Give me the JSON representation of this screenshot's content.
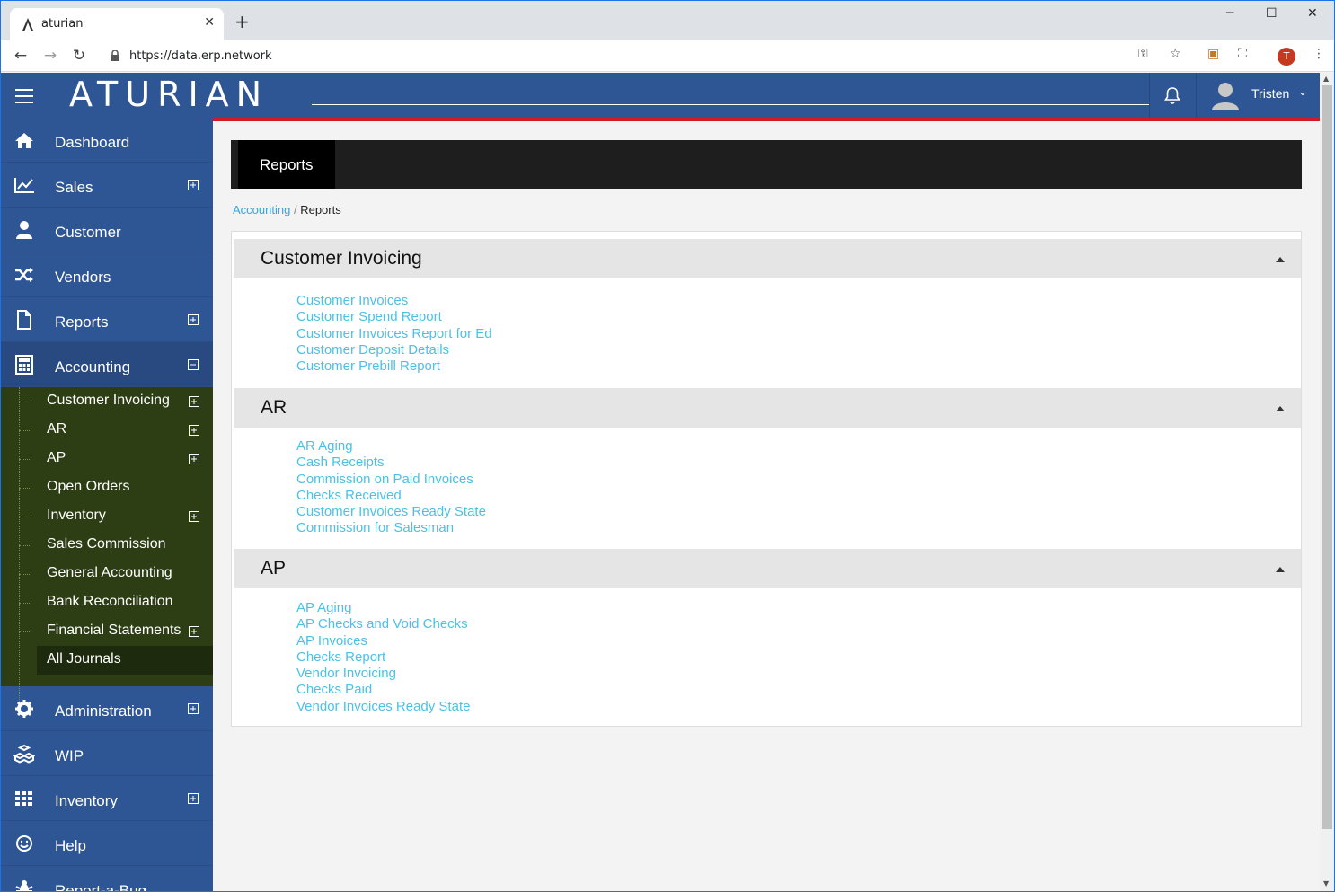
{
  "browser": {
    "tab_title": "aturian",
    "tab_close": "✕",
    "new_tab": "+",
    "url": "https://data.erp.network",
    "profile_initial": "T",
    "window_controls": [
      "─",
      "☐",
      "✕"
    ]
  },
  "header": {
    "logo": "ATURIAN",
    "user_name": "Tristen"
  },
  "sidebar": {
    "items": [
      {
        "label": "Dashboard",
        "icon": "home-icon",
        "expandable": false
      },
      {
        "label": "Sales",
        "icon": "chart-line-icon",
        "expandable": true
      },
      {
        "label": "Customer",
        "icon": "user-icon",
        "expandable": false
      },
      {
        "label": "Vendors",
        "icon": "shuffle-icon",
        "expandable": false
      },
      {
        "label": "Reports",
        "icon": "file-icon",
        "expandable": true
      },
      {
        "label": "Accounting",
        "icon": "calculator-icon",
        "expandable": true,
        "expanded": true
      }
    ],
    "accounting_sub": [
      {
        "label": "Customer Invoicing",
        "expandable": true
      },
      {
        "label": "AR",
        "expandable": true
      },
      {
        "label": "AP",
        "expandable": true
      },
      {
        "label": "Open Orders",
        "expandable": false
      },
      {
        "label": "Inventory",
        "expandable": true
      },
      {
        "label": "Sales Commission",
        "expandable": false
      },
      {
        "label": "General Accounting",
        "expandable": false
      },
      {
        "label": "Bank Reconciliation",
        "expandable": false
      },
      {
        "label": "Financial Statements",
        "expandable": true
      },
      {
        "label": "All Journals",
        "expandable": false,
        "selected": true
      }
    ],
    "items_after": [
      {
        "label": "Administration",
        "icon": "gear-icon",
        "expandable": true
      },
      {
        "label": "WIP",
        "icon": "cubes-icon",
        "expandable": false
      },
      {
        "label": "Inventory",
        "icon": "grid-icon",
        "expandable": true
      },
      {
        "label": "Help",
        "icon": "smiley-icon",
        "expandable": false
      },
      {
        "label": "Report-a-Bug",
        "icon": "bug-icon",
        "expandable": false
      }
    ]
  },
  "page": {
    "tab": "Reports",
    "breadcrumb": {
      "parent": "Accounting",
      "sep": "/",
      "current": "Reports"
    }
  },
  "sections": [
    {
      "title": "Customer Invoicing",
      "links": [
        "Customer Invoices",
        "Customer Spend Report",
        "Customer Invoices Report for Ed",
        "Customer Deposit Details",
        "Customer Prebill Report"
      ]
    },
    {
      "title": "AR",
      "links": [
        "AR Aging",
        "Cash Receipts",
        "Commission on Paid Invoices",
        "Checks Received",
        "Customer Invoices Ready State",
        "Commission for Salesman"
      ]
    },
    {
      "title": "AP",
      "links": [
        "AP Aging",
        "AP Checks and Void Checks",
        "AP Invoices",
        "Checks Report",
        "Vendor Invoicing",
        "Checks Paid",
        "Vendor Invoices Ready State"
      ]
    }
  ],
  "colors": {
    "header_blue": "#2f5694",
    "accent_red": "#cc1c24",
    "link": "#4bc1e6",
    "submenu_bg": "#2d3d14"
  }
}
